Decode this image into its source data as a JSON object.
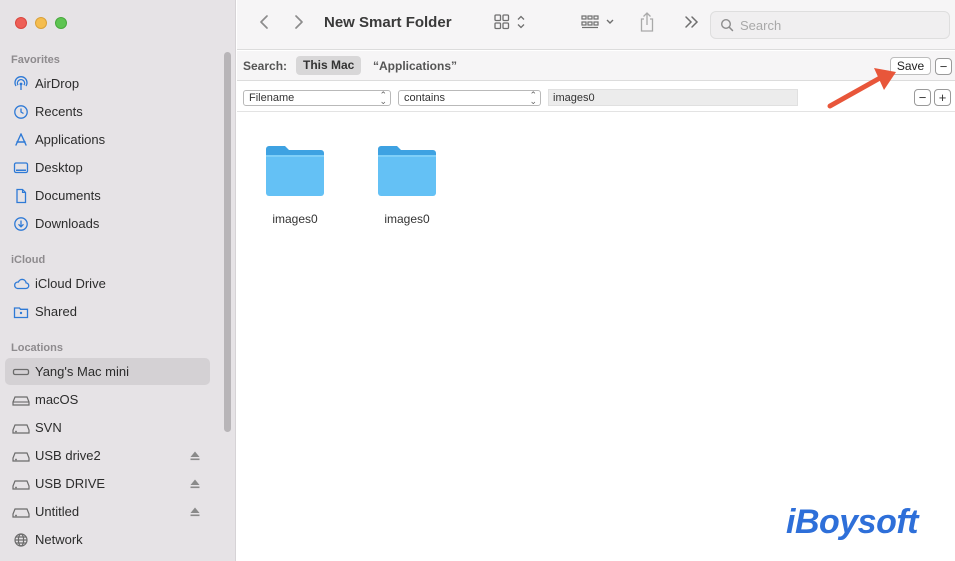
{
  "toolbar": {
    "title": "New Smart Folder",
    "search_placeholder": "Search"
  },
  "sidebar": {
    "favorites_title": "Favorites",
    "favorites": [
      {
        "label": "AirDrop",
        "icon": "airdrop-icon"
      },
      {
        "label": "Recents",
        "icon": "clock-icon"
      },
      {
        "label": "Applications",
        "icon": "applications-icon"
      },
      {
        "label": "Desktop",
        "icon": "desktop-icon"
      },
      {
        "label": "Documents",
        "icon": "document-icon"
      },
      {
        "label": "Downloads",
        "icon": "download-icon"
      }
    ],
    "icloud_title": "iCloud",
    "icloud": [
      {
        "label": "iCloud Drive",
        "icon": "cloud-icon"
      },
      {
        "label": "Shared",
        "icon": "shared-folder-icon"
      }
    ],
    "locations_title": "Locations",
    "locations": [
      {
        "label": "Yang's Mac mini",
        "icon": "mac-mini-icon",
        "selected": true
      },
      {
        "label": "macOS",
        "icon": "disk-icon"
      },
      {
        "label": "SVN",
        "icon": "external-disk-icon"
      },
      {
        "label": "USB drive2",
        "icon": "external-disk-icon",
        "eject": true
      },
      {
        "label": "USB DRIVE",
        "icon": "external-disk-icon",
        "eject": true
      },
      {
        "label": "Untitled",
        "icon": "external-disk-icon",
        "eject": true
      },
      {
        "label": "Network",
        "icon": "globe-icon"
      }
    ]
  },
  "scope": {
    "label": "Search:",
    "this_mac": "This Mac",
    "applications": "“Applications”",
    "save": "Save",
    "minus": "−"
  },
  "criteria": {
    "attribute": "Filename",
    "operator": "contains",
    "value": "images0",
    "minus": "−",
    "plus": "+"
  },
  "files": [
    {
      "name": "images0"
    },
    {
      "name": "images0"
    }
  ],
  "watermark": "iBoysoft",
  "colors": {
    "accent": "#2e6fd9",
    "folder": "#5ab8f0",
    "arrow": "#e8563a"
  }
}
